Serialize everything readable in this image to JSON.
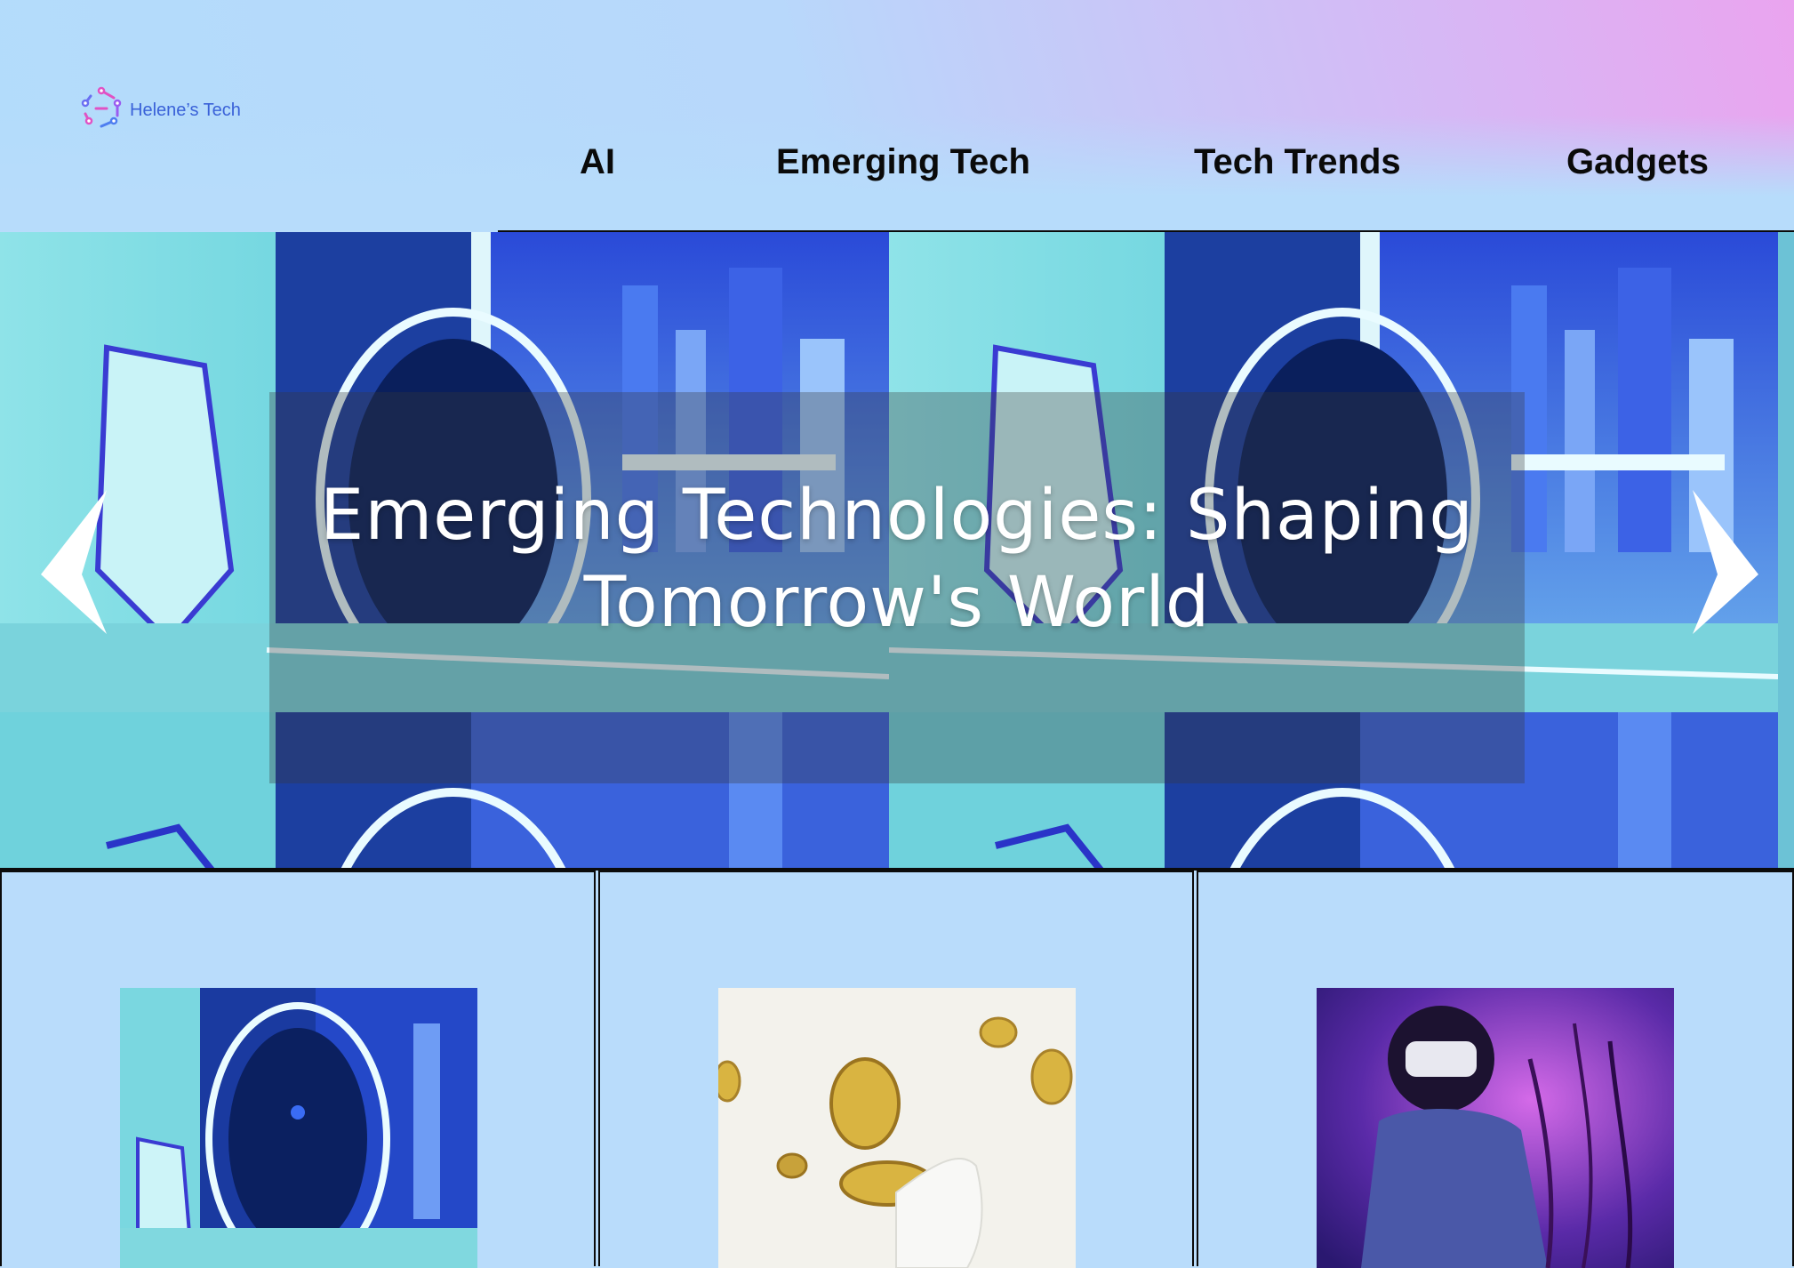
{
  "brand": {
    "name": "Helene’s Tech",
    "logo_icon": "hexagonal-circuit-logo-icon"
  },
  "nav": {
    "items": [
      {
        "label": "AI"
      },
      {
        "label": "Emerging Tech"
      },
      {
        "label": "Tech Trends"
      },
      {
        "label": "Gadgets"
      }
    ]
  },
  "hero": {
    "title_line1": "Emerging Technologies: Shaping",
    "title_line2": "Tomorrow's World",
    "prev_icon": "chevron-left-icon",
    "next_icon": "chevron-right-icon"
  },
  "cards": [
    {
      "image": "futuristic-pod-chair-image"
    },
    {
      "image": "floating-gold-coins-image"
    },
    {
      "image": "vr-headset-woman-image"
    }
  ],
  "colors": {
    "page_bg": "#b9dcfb",
    "header_gradient_start": "#b3dcfb",
    "header_gradient_end": "#eaa4ef",
    "brand_text": "#3a62d8",
    "nav_text": "#0a0a0a",
    "hero_title": "#ffffff"
  }
}
